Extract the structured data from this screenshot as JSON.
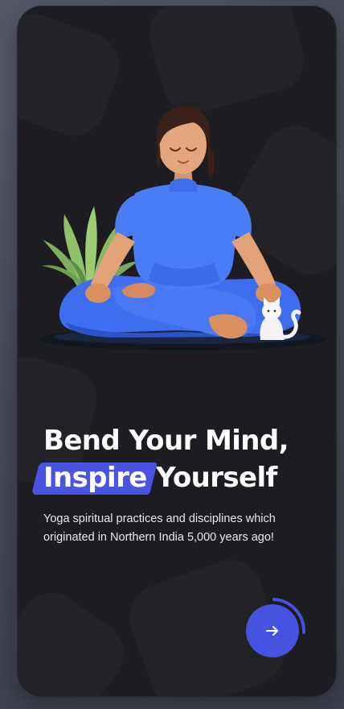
{
  "onboarding": {
    "headline_line1": "Bend Your Mind,",
    "headline_highlight": "Inspire",
    "headline_line2_rest": " Yourself",
    "subtitle": "Yoga spiritual practices and disciplines which originated in Northern India 5,000 years ago!",
    "next_icon": "arrow-right-icon",
    "progress_fraction": 0.25
  },
  "colors": {
    "background": "#1d1c20",
    "accent": "#4852e0",
    "text": "#ffffff"
  }
}
